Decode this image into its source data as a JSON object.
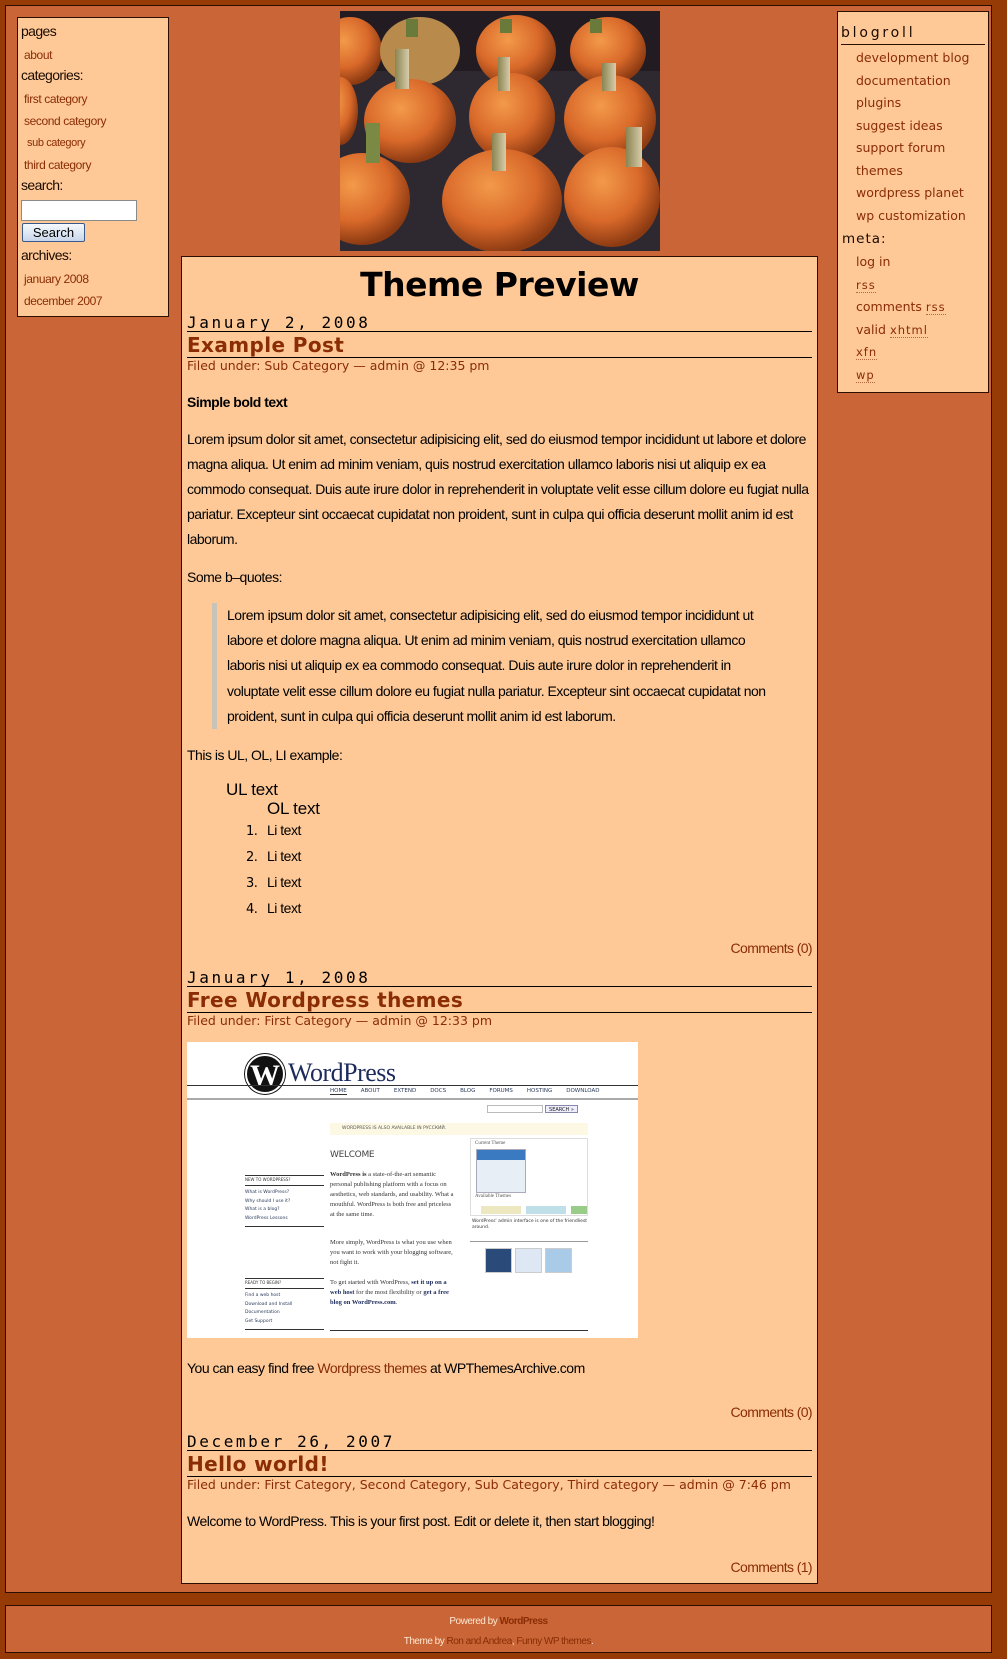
{
  "sidebar_left": {
    "pages_heading": "pages",
    "pages": [
      "about"
    ],
    "categories_heading": "categories:",
    "categories": [
      {
        "label": "first category",
        "sub": false
      },
      {
        "label": "second category",
        "sub": false
      },
      {
        "label": "sub category",
        "sub": true
      },
      {
        "label": "third category",
        "sub": false
      }
    ],
    "search_heading": "search:",
    "search_value": "",
    "search_button": "Search",
    "archives_heading": "archives:",
    "archives": [
      "january 2008",
      "december 2007"
    ]
  },
  "sidebar_right": {
    "blogroll_heading": "blogroll",
    "blogroll": [
      "development blog",
      "documentation",
      "plugins",
      "suggest ideas",
      "support forum",
      "themes",
      "wordpress planet",
      "wp customization"
    ],
    "meta_heading": "meta:",
    "meta": {
      "log_in": "log in",
      "rss": "rss",
      "comments_prefix": "comments",
      "comments_rss": "rss",
      "valid_prefix": "valid",
      "xhtml": "xhtml",
      "xfn": "xfn",
      "wp": "wp"
    }
  },
  "header": {
    "image_alt": "pumpkins header image",
    "site_title": "Theme Preview"
  },
  "posts": [
    {
      "date": "January 2, 2008",
      "title": "Example Post",
      "filed_prefix": "Filed under:",
      "categories": "Sub Category",
      "author_time": "— admin @ 12:35 pm",
      "bold_text": "Simple bold text",
      "paragraph": "Lorem ipsum dolor sit amet, consectetur adipisicing elit, sed do eiusmod tempor incididunt ut labore et dolore magna aliqua. Ut enim ad minim veniam, quis nostrud exercitation ullamco laboris nisi ut aliquip ex ea commodo consequat. Duis aute irure dolor in reprehenderit in voluptate velit esse cillum dolore eu fugiat nulla pariatur. Excepteur sint occaecat cupidatat non proident, sunt in culpa qui officia deserunt mollit anim id est laborum.",
      "bquote_intro": "Some b–quotes:",
      "blockquote": "Lorem ipsum dolor sit amet, consectetur adipisicing elit, sed do eiusmod tempor incididunt ut labore et dolore magna aliqua. Ut enim ad minim veniam, quis nostrud exercitation ullamco laboris nisi ut aliquip ex ea commodo consequat. Duis aute irure dolor in reprehenderit in voluptate velit esse cillum dolore eu fugiat nulla pariatur. Excepteur sint occaecat cupidatat non proident, sunt in culpa qui officia deserunt mollit anim id est laborum.",
      "list_intro": "This is UL, OL, LI example:",
      "ul_text": "UL text",
      "ol_text": "OL text",
      "list_items": [
        "Li text",
        "Li text",
        "Li text",
        "Li text"
      ],
      "comments": "Comments (0)"
    },
    {
      "date": "January 1, 2008",
      "title": "Free Wordpress themes",
      "filed_prefix": "Filed under:",
      "categories": "First Category",
      "author_time": "— admin @ 12:33 pm",
      "text_before": "You can easy find free ",
      "link_text": "Wordpress themes",
      "text_after": " at WPThemesArchive.com",
      "comments": "Comments (0)",
      "screenshot": {
        "logo": "WordPress",
        "nav": [
          "HOME",
          "ABOUT",
          "EXTEND",
          "DOCS",
          "BLOG",
          "FORUMS",
          "HOSTING",
          "DOWNLOAD"
        ],
        "search_button": "SEARCH »",
        "notice": "WORDPRESS IS ALSO AVAILABLE IN РУССКИЙ.",
        "welcome": "WELCOME",
        "intro_bold": "WordPress is",
        "intro": " a state-of-the-art semantic personal publishing platform with a focus on aesthetics, web standards, and usability. What a mouthful. WordPress is both free and priceless at the same time.",
        "para2": "More simply, WordPress is what you use when you want to work with your blogging software, not fight it.",
        "para3_a": "To get started with WordPress, ",
        "para3_link1": "set it up on a web host",
        "para3_b": " for the most flexibility or ",
        "para3_link2": "get a free blog on WordPress.com",
        "para3_c": ".",
        "new_heading": "NEW TO WORDPRESS?",
        "new_links": [
          "What is WordPress?",
          "Why should I use it?",
          "What is a blog?",
          "WordPress Lessons"
        ],
        "ready_heading": "READY TO BEGIN?",
        "ready_links": [
          "Find a web host",
          "Download and Install",
          "Documentation",
          "Get Support"
        ],
        "current_theme": "Current Theme",
        "available_themes": "Available Themes",
        "caption": "WordPress' admin interface is one of the friendliest around."
      }
    },
    {
      "date": "December 26, 2007",
      "title": "Hello world!",
      "filed_prefix": "Filed under:",
      "categories": "First Category, Second Category, Sub Category, Third category",
      "author_time": "— admin @ 7:46 pm",
      "body": "Welcome to WordPress. This is your first post. Edit or delete it, then start blogging!",
      "comments": "Comments (1)"
    }
  ],
  "footer": {
    "powered_prefix": "Powered by ",
    "powered_link": "WordPress",
    "theme_prefix": "Theme by ",
    "theme_link": "Ron and Andrea",
    "theme_sep": ", ",
    "theme_link2": "Funny WP themes",
    "theme_suffix": "."
  },
  "colors": {
    "outer_bg": "#963a06",
    "page_bg": "#c96536",
    "panel_bg": "#fec997",
    "link": "#8a2c04"
  }
}
